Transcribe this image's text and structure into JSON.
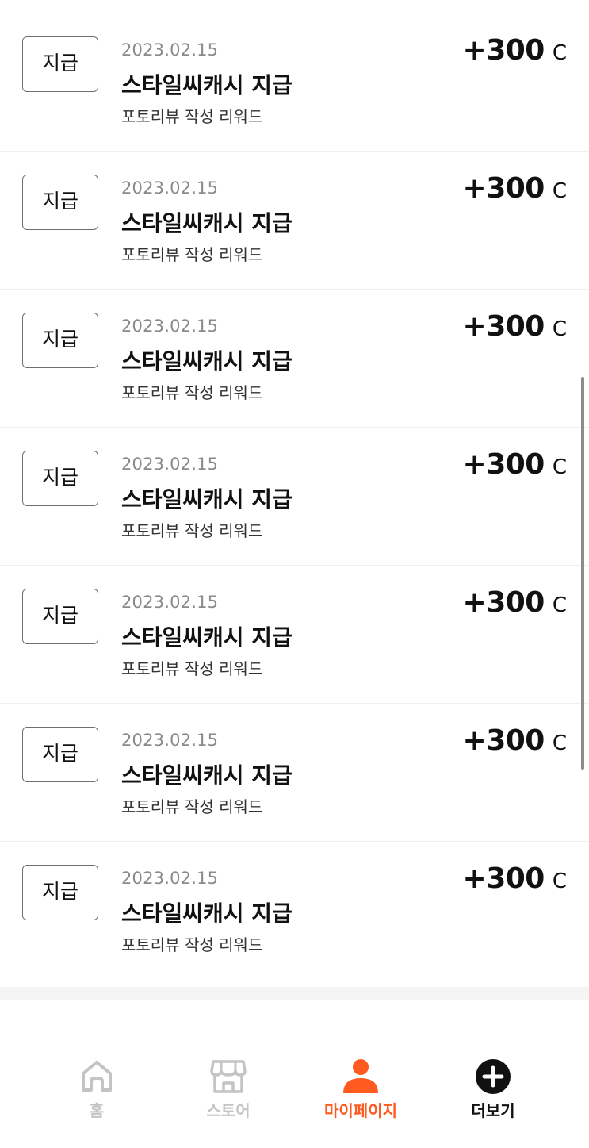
{
  "transactions": [
    {
      "type": "지급",
      "date": "2023.02.15",
      "title": "스타일씨캐시 지급",
      "description": "포토리뷰 작성 리워드",
      "amount": "+300",
      "unit": "C"
    },
    {
      "type": "지급",
      "date": "2023.02.15",
      "title": "스타일씨캐시 지급",
      "description": "포토리뷰 작성 리워드",
      "amount": "+300",
      "unit": "C"
    },
    {
      "type": "지급",
      "date": "2023.02.15",
      "title": "스타일씨캐시 지급",
      "description": "포토리뷰 작성 리워드",
      "amount": "+300",
      "unit": "C"
    },
    {
      "type": "지급",
      "date": "2023.02.15",
      "title": "스타일씨캐시 지급",
      "description": "포토리뷰 작성 리워드",
      "amount": "+300",
      "unit": "C"
    },
    {
      "type": "지급",
      "date": "2023.02.15",
      "title": "스타일씨캐시 지급",
      "description": "포토리뷰 작성 리워드",
      "amount": "+300",
      "unit": "C"
    },
    {
      "type": "지급",
      "date": "2023.02.15",
      "title": "스타일씨캐시 지급",
      "description": "포토리뷰 작성 리워드",
      "amount": "+300",
      "unit": "C"
    },
    {
      "type": "지급",
      "date": "2023.02.15",
      "title": "스타일씨캐시 지급",
      "description": "포토리뷰 작성 리워드",
      "amount": "+300",
      "unit": "C"
    }
  ],
  "nav": {
    "items": [
      {
        "label": "홈",
        "icon": "home-icon",
        "active": false
      },
      {
        "label": "스토어",
        "icon": "store-icon",
        "active": false
      },
      {
        "label": "마이페이지",
        "icon": "person-icon",
        "active": true
      },
      {
        "label": "더보기",
        "icon": "plus-circle-icon",
        "active": false
      }
    ]
  },
  "colors": {
    "accent": "#ff5a1f",
    "inactive": "#c4c4c4",
    "text": "#111111",
    "muted": "#8a8a8a"
  }
}
